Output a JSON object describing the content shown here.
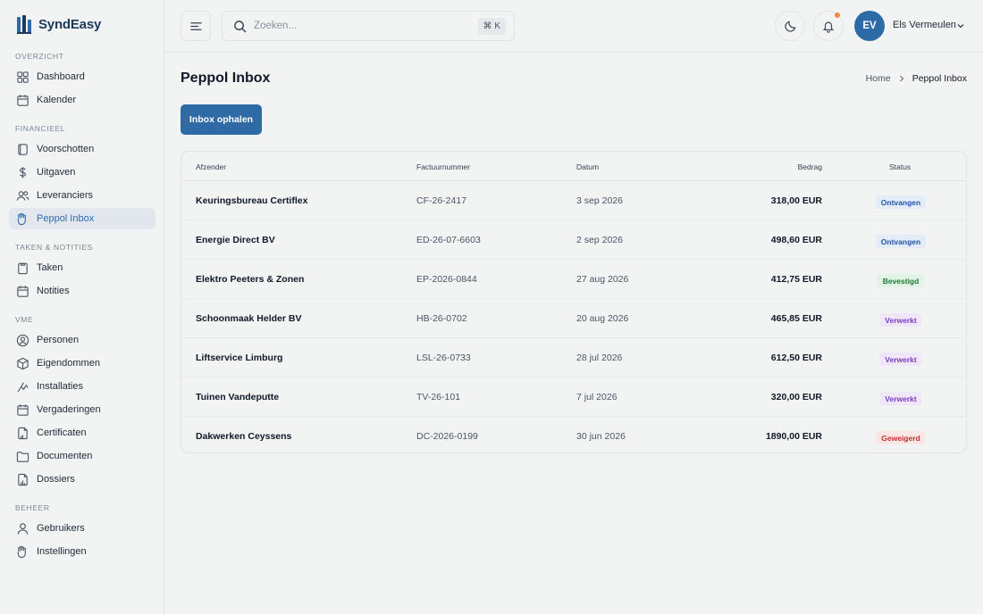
{
  "brand": {
    "name": "SyndEasy"
  },
  "sidebar": {
    "sections": [
      {
        "title": "OVERZICHT"
      },
      {
        "title": "FINANCIEEL"
      },
      {
        "title": "TAKEN & NOTITIES"
      },
      {
        "title": "VME"
      },
      {
        "title": "BEHEER"
      }
    ],
    "items": [
      {
        "label": "Dashboard",
        "icon": "dashboard-icon"
      },
      {
        "label": "Kalender",
        "icon": "calendar-icon"
      },
      {
        "label": "Voorschotten",
        "icon": "wallet-icon"
      },
      {
        "label": "Uitgaven",
        "icon": "dollar-icon"
      },
      {
        "label": "Leveranciers",
        "icon": "users-icon"
      },
      {
        "label": "Peppol Inbox",
        "icon": "inbox-icon",
        "active": true
      },
      {
        "label": "Taken",
        "icon": "clipboard-icon"
      },
      {
        "label": "Notities",
        "icon": "note-icon"
      },
      {
        "label": "Personen",
        "icon": "person-circle-icon"
      },
      {
        "label": "Eigendommen",
        "icon": "box-icon"
      },
      {
        "label": "Installaties",
        "icon": "tool-icon"
      },
      {
        "label": "Vergaderingen",
        "icon": "calendar-icon"
      },
      {
        "label": "Certificaten",
        "icon": "certificate-icon"
      },
      {
        "label": "Documenten",
        "icon": "folder-icon"
      },
      {
        "label": "Dossiers",
        "icon": "building-icon"
      },
      {
        "label": "Gebruikers",
        "icon": "user-icon"
      },
      {
        "label": "Instellingen",
        "icon": "settings-icon"
      }
    ]
  },
  "topbar": {
    "search_placeholder": "Zoeken...",
    "shortcut": "⌘ K",
    "user": {
      "initials": "EV",
      "name": "Els Vermeulen"
    }
  },
  "page": {
    "title": "Peppol Inbox",
    "breadcrumb": {
      "home": "Home",
      "current": "Peppol Inbox"
    },
    "fetch_button": "Inbox ophalen"
  },
  "table": {
    "headers": {
      "sender": "Afzender",
      "invoice": "Factuurnummer",
      "date": "Datum",
      "amount": "Bedrag",
      "status": "Status"
    },
    "rows": [
      {
        "sender": "Keuringsbureau Certiflex",
        "invoice": "CF-26-2417",
        "date": "3 sep 2026",
        "amount": "318,00 EUR",
        "status": "Ontvangen"
      },
      {
        "sender": "Energie Direct BV",
        "invoice": "ED-26-07-6603",
        "date": "2 sep 2026",
        "amount": "498,60 EUR",
        "status": "Ontvangen"
      },
      {
        "sender": "Elektro Peeters & Zonen",
        "invoice": "EP-2026-0844",
        "date": "27 aug 2026",
        "amount": "412,75 EUR",
        "status": "Bevestigd"
      },
      {
        "sender": "Schoonmaak Helder BV",
        "invoice": "HB-26-0702",
        "date": "20 aug 2026",
        "amount": "465,85 EUR",
        "status": "Verwerkt"
      },
      {
        "sender": "Liftservice Limburg",
        "invoice": "LSL-26-0733",
        "date": "28 jul 2026",
        "amount": "612,50 EUR",
        "status": "Verwerkt"
      },
      {
        "sender": "Tuinen Vandeputte",
        "invoice": "TV-26-101",
        "date": "7 jul 2026",
        "amount": "320,00 EUR",
        "status": "Verwerkt"
      },
      {
        "sender": "Dakwerken Ceyssens",
        "invoice": "DC-2026-0199",
        "date": "30 jun 2026",
        "amount": "1890,00 EUR",
        "status": "Geweigerd"
      }
    ]
  },
  "colors": {
    "accent": "#2e6aa5",
    "brand": "#1b3a5c",
    "status_ontvangen": "#2255a8",
    "status_bevestigd": "#1e7a34",
    "status_verwerkt": "#7c3fc0",
    "status_geweigerd": "#c2312f",
    "notification_dot": "#f08a4b"
  }
}
